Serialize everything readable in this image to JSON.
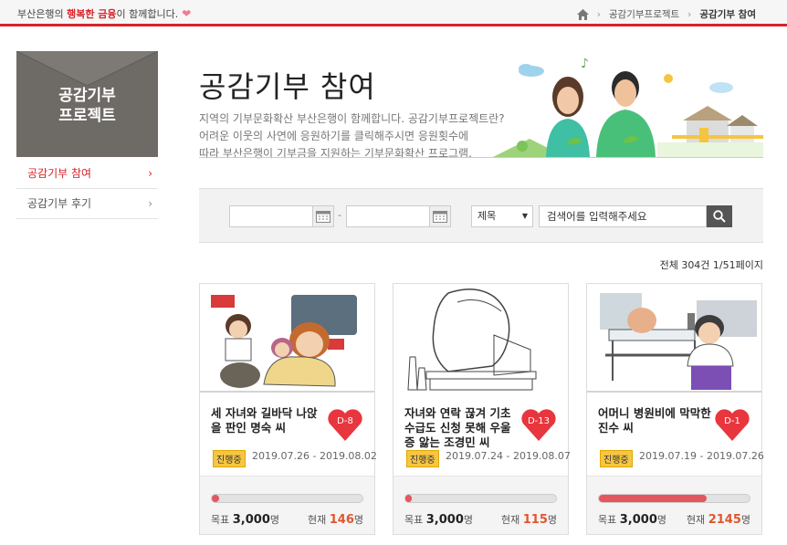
{
  "topbar": {
    "slogan_pre": "부산은행의 ",
    "slogan_em": "행복한 금융",
    "slogan_post": "이 함께합니다.",
    "breadcrumb": [
      "공감기부프로젝트",
      "공감기부 참여"
    ]
  },
  "nav": {
    "title_line1": "공감기부",
    "title_line2": "프로젝트",
    "items": [
      {
        "label": "공감기부 참여"
      },
      {
        "label": "공감기부 후기"
      }
    ]
  },
  "heading": {
    "title": "공감기부 참여",
    "desc": [
      "지역의 기부문화확산 부산은행이 함께합니다. 공감기부프로젝트란?",
      "어려운 이웃의 사연에 응원하기를 클릭해주시면 응원횟수에",
      "따라 부산은행이 기부금을 지원하는 기부문화확산 프로그램."
    ]
  },
  "search": {
    "start_date": "",
    "end_date": "",
    "date_sep": "-",
    "field": "제목",
    "placeholder": "검색어를 입력해주세요"
  },
  "count_text": "전체 304건 1/51페이지",
  "cards": [
    {
      "title": "세 자녀와 길바닥 나앉을 판인 명숙 씨",
      "dday": "D-8",
      "status": "진행중",
      "period": "2019.07.26 - 2019.08.02",
      "goal_label": "목표",
      "goal": "3,000",
      "goal_unit": "명",
      "current_label": "현재",
      "current": "146",
      "current_unit": "명",
      "progress": 0.0487
    },
    {
      "title": "자녀와 연락 끊겨 기초수급도 신청 못해 우울증 앓는 조경민 씨",
      "dday": "D-13",
      "status": "진행중",
      "period": "2019.07.24 - 2019.08.07",
      "goal_label": "목표",
      "goal": "3,000",
      "goal_unit": "명",
      "current_label": "현재",
      "current": "115",
      "current_unit": "명",
      "progress": 0.0383
    },
    {
      "title": "어머니 병원비에 막막한 진수 씨",
      "dday": "D-1",
      "status": "진행중",
      "period": "2019.07.19 - 2019.07.26",
      "goal_label": "목표",
      "goal": "3,000",
      "goal_unit": "명",
      "current_label": "현재",
      "current": "2145",
      "current_unit": "명",
      "progress": 0.715
    }
  ],
  "colors": {
    "accent": "#d8232a",
    "heart": "#e8363e",
    "status": "#f6c544"
  }
}
